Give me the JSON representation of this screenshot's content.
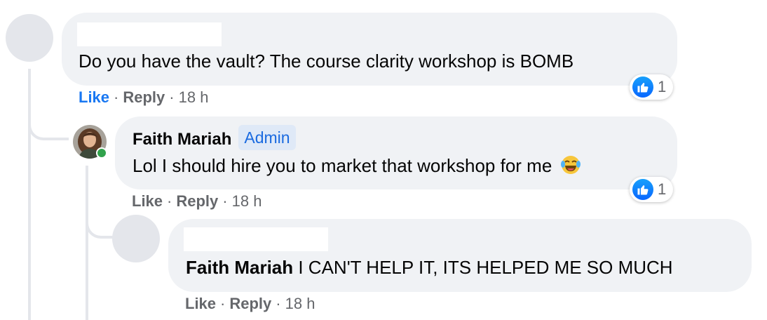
{
  "comments": [
    {
      "text": "Do you have the vault? The course clarity workshop is BOMB",
      "actions": {
        "like": "Like",
        "reply": "Reply",
        "time": "18 h"
      },
      "reaction_count": "1"
    },
    {
      "author": "Faith Mariah",
      "badge": "Admin",
      "text": "Lol I should hire you to market that workshop for me",
      "emoji": "laughing-tears-emoji",
      "actions": {
        "like": "Like",
        "reply": "Reply",
        "time": "18 h"
      },
      "reaction_count": "1",
      "online": true
    },
    {
      "mention": "Faith Mariah",
      "text": " I CAN'T HELP IT, ITS HELPED ME SO MUCH",
      "actions": {
        "like": "Like",
        "reply": "Reply",
        "time": "18 h"
      }
    }
  ],
  "colors": {
    "bubble": "#f0f2f5",
    "like_active": "#1877f2",
    "meta": "#65676b",
    "admin_bg": "#dfe9f7",
    "admin_text": "#1b6be0",
    "online": "#31a24c"
  }
}
